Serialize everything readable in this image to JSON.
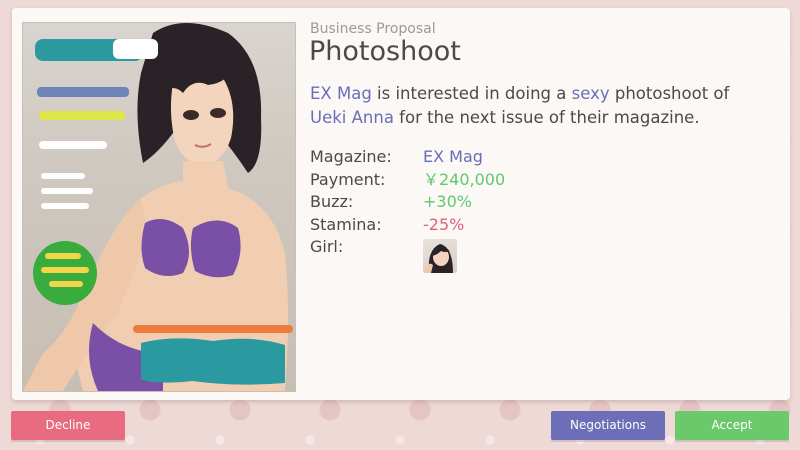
{
  "proposal": {
    "category": "Business Proposal",
    "title": "Photoshoot",
    "description": {
      "company": "EX Mag",
      "part1": " is interested in doing a ",
      "adjective": "sexy",
      "part2": " photoshoot of ",
      "girl": "Ueki Anna",
      "part3": " for the next issue of their magazine."
    }
  },
  "details": {
    "magazine_label": "Magazine:",
    "magazine_value": "EX Mag",
    "payment_label": "Payment:",
    "payment_value": "￥240,000",
    "buzz_label": "Buzz:",
    "buzz_value": "+30%",
    "stamina_label": "Stamina:",
    "stamina_value": "-25%",
    "girl_label": "Girl:"
  },
  "buttons": {
    "decline": "Decline",
    "negotiations": "Negotiations",
    "accept": "Accept"
  },
  "colors": {
    "highlight": "#6a6eb8",
    "positive": "#5ec96d",
    "negative": "#e0607a",
    "decline": "#e86b80",
    "negotiations": "#6c6fb8",
    "accept": "#6ac96a"
  },
  "icons": {
    "magazine_cover": "magazine-cover-image",
    "girl_portrait": "girl-portrait-icon"
  }
}
